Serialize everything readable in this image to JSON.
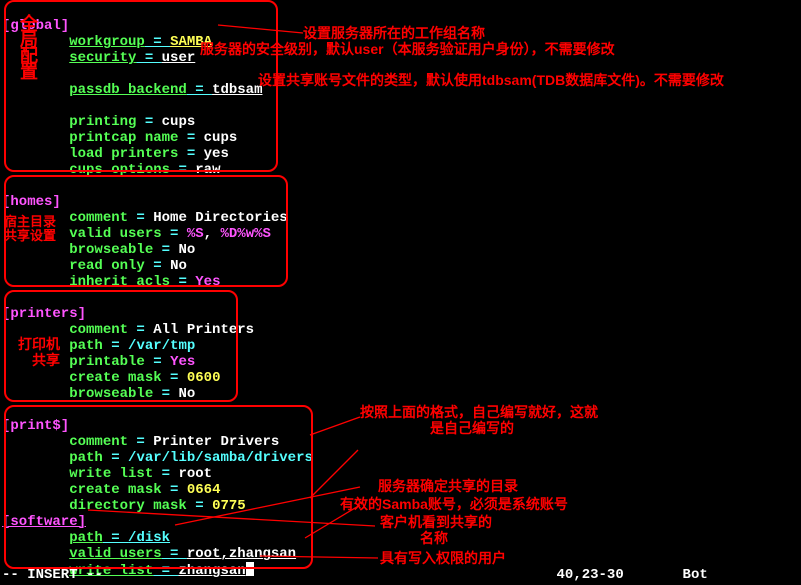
{
  "sections": {
    "global": {
      "header": "[global]",
      "lines": {
        "workgroup": {
          "key": "workgroup",
          "eq": " = ",
          "val": "SAMBA"
        },
        "security": {
          "key": "security",
          "eq": " = ",
          "val": "user"
        },
        "blank1": "",
        "passdb": {
          "key": "passdb backend",
          "eq": " = ",
          "val": "tdbsam"
        },
        "blank2": "",
        "printing": {
          "key": "printing",
          "eq": " = ",
          "val": "cups"
        },
        "printcap": {
          "key": "printcap name",
          "eq": " = ",
          "val": "cups"
        },
        "loadp": {
          "key": "load printers",
          "eq": " = ",
          "val": "yes"
        },
        "cupsopt": {
          "key": "cups options",
          "eq": " = ",
          "val": "raw"
        }
      }
    },
    "homes": {
      "header": "[homes]",
      "lines": {
        "comment": {
          "key": "comment",
          "eq": " = ",
          "val": "Home Directories"
        },
        "valid": {
          "key": "valid users",
          "eq": " = ",
          "val1": "%S",
          "sep": ", ",
          "val2": "%D%w%S"
        },
        "browse": {
          "key": "browseable",
          "eq": " = ",
          "val": "No"
        },
        "readonly": {
          "key": "read only",
          "eq": " = ",
          "val": "No"
        },
        "inherit": {
          "key": "inherit acls",
          "eq": " = ",
          "val": "Yes"
        }
      }
    },
    "printers": {
      "header": "[printers]",
      "lines": {
        "comment": {
          "key": "comment",
          "eq": " = ",
          "val": "All Printers"
        },
        "path": {
          "key": "path",
          "eq": " = ",
          "val": "/var/tmp"
        },
        "printable": {
          "key": "printable",
          "eq": " = ",
          "val": "Yes"
        },
        "cmask": {
          "key": "create mask",
          "eq": " = ",
          "val": "0600"
        },
        "browse": {
          "key": "browseable",
          "eq": " = ",
          "val": "No"
        }
      }
    },
    "printd": {
      "header": "[print$]",
      "lines": {
        "comment": {
          "key": "comment",
          "eq": " = ",
          "val": "Printer Drivers"
        },
        "path": {
          "key": "path",
          "eq": " = ",
          "val": "/var/lib/samba/drivers"
        },
        "wlist": {
          "key": "write list",
          "eq": " = ",
          "val": "root"
        },
        "cmask": {
          "key": "create mask",
          "eq": " = ",
          "val": "0664"
        },
        "dmask": {
          "key": "directory mask",
          "eq": " = ",
          "val": "0775"
        }
      }
    },
    "software": {
      "header": "[software]",
      "lines": {
        "path": {
          "key": "path",
          "eq": " = ",
          "val": "/disk"
        },
        "valid": {
          "key": "valid users",
          "eq": " = ",
          "val": "root,zhangsan"
        },
        "wlist": {
          "key": "write list",
          "eq": " = ",
          "val": "zhangsan"
        }
      }
    }
  },
  "annotations": {
    "global_label": "全局配置",
    "workgroup_note": "设置服务器所在的工作组名称",
    "security_note": "服务器的安全级别，默认user（本服务验证用户身份），不需要修改",
    "passdb_note": "设置共享账号文件的类型，默认使用tdbsam(TDB数据库文件)。不需要修改",
    "homes_label1": "宿主目录",
    "homes_label2": "共享设置",
    "printers_label1": "打印机",
    "printers_label2": "共享",
    "printd_note1": "按照上面的格式，自己编写就好，这就",
    "printd_note2": "是自己编写的",
    "path_note": "服务器确定共享的目录",
    "valid_note": "有效的Samba账号，必须是系统账号",
    "soft_note1": "客户机看到共享的",
    "soft_note2": "名称",
    "wlist_note": "具有写入权限的用户"
  },
  "status": {
    "mode": "-- INSERT --",
    "pos": "40,23-30",
    "scroll": "Bot"
  }
}
